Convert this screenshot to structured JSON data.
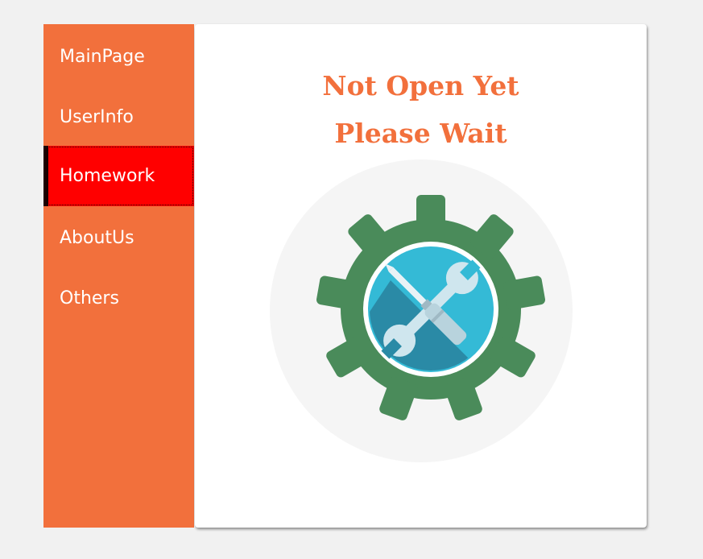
{
  "sidebar": {
    "items": [
      {
        "label": "MainPage"
      },
      {
        "label": "UserInfo"
      },
      {
        "label": "Homework",
        "active": true
      },
      {
        "label": "AboutUs"
      },
      {
        "label": "Others"
      }
    ]
  },
  "main": {
    "title_line1": "Not Open Yet",
    "title_line2": "Please Wait",
    "illustration_icon": "gear-with-tools-icon"
  },
  "colors": {
    "accent": "#f2703c",
    "active_item": "#ff0000",
    "gear": "#4a8b5a",
    "tool_circle": "#34bad6"
  }
}
